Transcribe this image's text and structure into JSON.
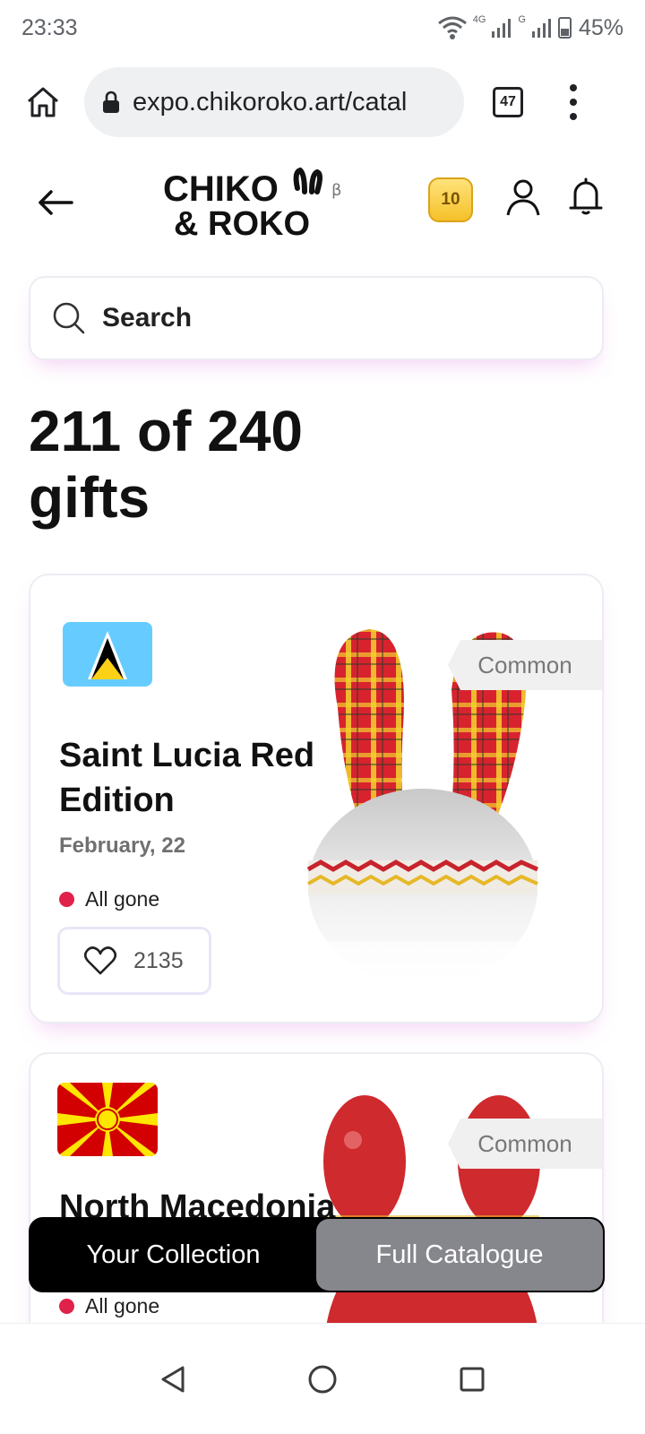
{
  "status_bar": {
    "time": "23:33",
    "network_labels": [
      "4G",
      "G"
    ],
    "battery": "45%"
  },
  "browser": {
    "url": "expo.chikoroko.art/catal",
    "tab_count": "47"
  },
  "header": {
    "logo_line1": "CHIKO",
    "logo_line2": "& ROKO",
    "logo_beta": "β",
    "coins": "10"
  },
  "search": {
    "placeholder": "Search"
  },
  "page": {
    "heading": "211 of 240 gifts"
  },
  "gifts": [
    {
      "title": "Saint Lucia Red Edition",
      "date": "February, 22",
      "rarity": "Common",
      "availability": "All gone",
      "likes": "2135"
    },
    {
      "title": "North Macedonia",
      "rarity": "Common",
      "availability": "All gone"
    }
  ],
  "tabs": {
    "collection": "Your Collection",
    "catalogue": "Full Catalogue"
  },
  "colors": {
    "accent_red": "#e0214a",
    "coin_gold": "#f5c12a",
    "active_tab": "#86878c"
  }
}
